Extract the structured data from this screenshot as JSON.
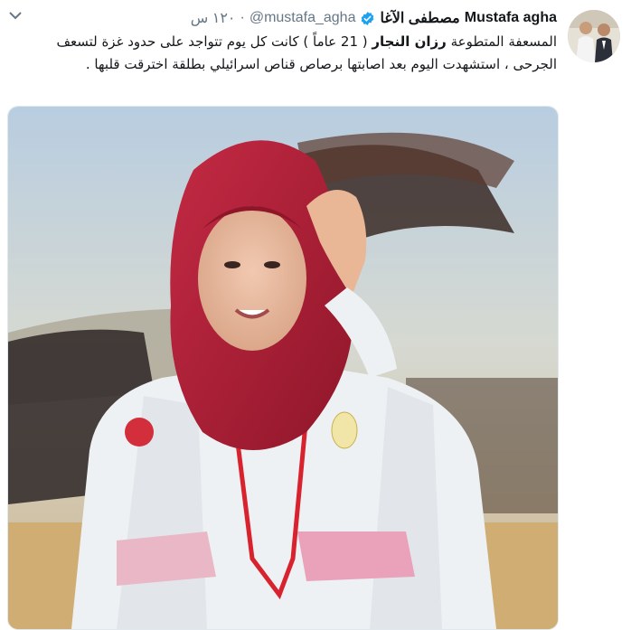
{
  "tweet": {
    "author_name_en": "Mustafa agha",
    "author_name_ar": "مصطفى الآغا",
    "handle": "@mustafa_agha",
    "separator": "·",
    "time": "١٢٠ س",
    "verified_icon": "verified-badge-icon",
    "caret_icon": "chevron-down-icon",
    "text_part1": "المسعفة المتطوعة ",
    "text_bold": "رزان النجار",
    "text_part2": " ( 21 عاماً )  كانت كل يوم تتواجد على حدود غزة لتسعف الجرحى ، استشهدت اليوم بعد اصابتها برصاص قناص اسرائيلي بطلقة اخترقت قلبها .",
    "media_alt": "",
    "colors": {
      "verified": "#1da1f2",
      "text": "#14171a",
      "secondary": "#657786",
      "scarf": "#b8223a"
    }
  }
}
